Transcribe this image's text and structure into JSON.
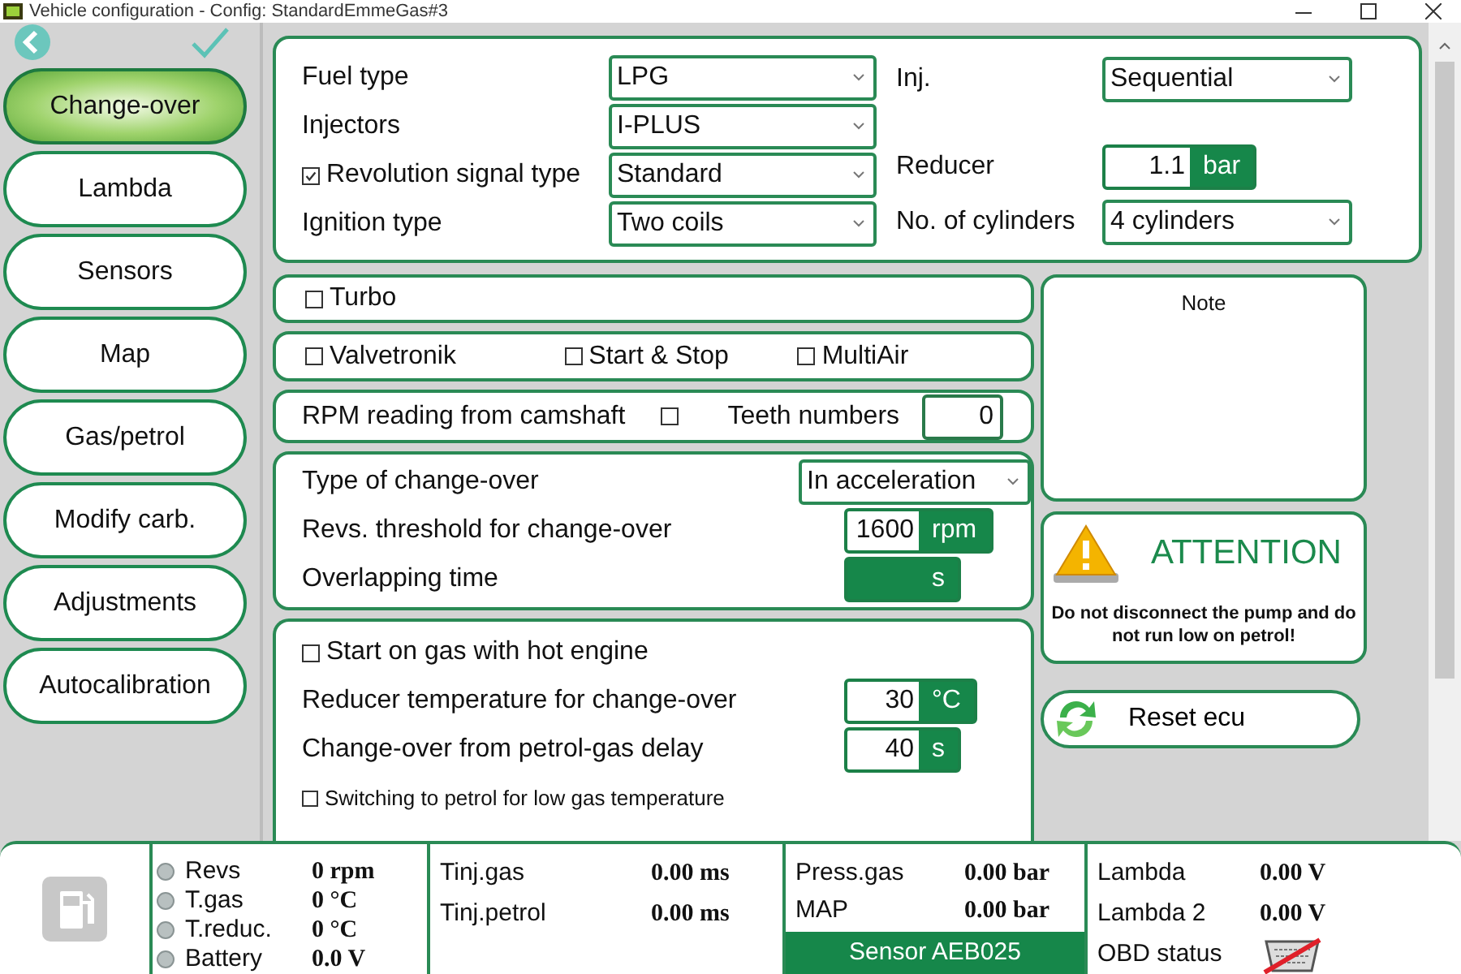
{
  "window": {
    "title": "Vehicle configuration - Config: StandardEmmeGas#3"
  },
  "sidebar": {
    "items": [
      {
        "label": "Change-over",
        "selected": true
      },
      {
        "label": "Lambda",
        "selected": false
      },
      {
        "label": "Sensors",
        "selected": false
      },
      {
        "label": "Map",
        "selected": false
      },
      {
        "label": "Gas/petrol",
        "selected": false
      },
      {
        "label": "Modify carb.",
        "selected": false
      },
      {
        "label": "Adjustments",
        "selected": false
      },
      {
        "label": "Autocalibration",
        "selected": false
      }
    ]
  },
  "engine": {
    "left_fields": [
      {
        "label": "Fuel type",
        "kind": "select",
        "value": "LPG"
      },
      {
        "label": "Injectors",
        "kind": "select",
        "value": "I-PLUS"
      },
      {
        "label": "Revolution signal type",
        "kind": "select",
        "value": "Standard",
        "checked": true
      },
      {
        "label": "Ignition type",
        "kind": "select",
        "value": "Two coils"
      }
    ],
    "right_fields": [
      {
        "label": "Inj.",
        "kind": "select",
        "value": "Sequential"
      },
      {
        "label": "Reducer",
        "kind": "numeric",
        "value": "1.1",
        "unit": "bar"
      },
      {
        "label": "No. of cylinders",
        "kind": "select",
        "value": "4 cylinders"
      }
    ]
  },
  "turbo": {
    "label": "Turbo",
    "checked": false
  },
  "options": [
    {
      "label": "Valvetronik",
      "checked": false
    },
    {
      "label": "Start & Stop",
      "checked": false
    },
    {
      "label": "MultiAir",
      "checked": false
    }
  ],
  "camshaft": {
    "label": "RPM reading from camshaft",
    "checked": false,
    "teeth_label": "Teeth numbers",
    "teeth_value": "0"
  },
  "changeover": {
    "fields": [
      {
        "kind": "select",
        "label": "Type of change-over",
        "value": "In acceleration"
      },
      {
        "kind": "numeric",
        "label": "Revs. threshold for change-over",
        "value": "1600",
        "unit": "rpm"
      },
      {
        "kind": "numeric",
        "label": "Overlapping time",
        "unit": "s"
      }
    ]
  },
  "hot_start": {
    "fields": [
      {
        "kind": "checkbox",
        "label": "Start on gas with hot engine",
        "checked": false
      },
      {
        "kind": "numeric",
        "label": "Reducer temperature for change-over",
        "value": "30",
        "unit": "°C"
      },
      {
        "kind": "numeric",
        "label": "Change-over from petrol-gas delay",
        "value": "40",
        "unit": "s"
      },
      {
        "kind": "small_checkbox",
        "label": "Switching to petrol for low gas temperature",
        "checked": false
      }
    ]
  },
  "note": {
    "title": "Note"
  },
  "attention": {
    "title": "ATTENTION",
    "message": "Do not disconnect the pump and do not run low on petrol!"
  },
  "reset_button": {
    "label": "Reset ecu"
  },
  "status_bar": {
    "engine": [
      {
        "label": "Revs",
        "value": "0 rpm"
      },
      {
        "label": "T.gas",
        "value": "0 °C"
      },
      {
        "label": "T.reduc.",
        "value": "0 °C"
      },
      {
        "label": "Battery",
        "value": "0.0 V"
      }
    ],
    "injection": [
      {
        "label": "Tinj.gas",
        "value": "0.00 ms"
      },
      {
        "label": "Tinj.petrol",
        "value": "0.00 ms"
      }
    ],
    "pressure": [
      {
        "label": "Press.gas",
        "value": "0.00 bar"
      },
      {
        "label": "MAP",
        "value": "0.00 bar"
      }
    ],
    "sensor": "Sensor AEB025",
    "lambda": [
      {
        "label": "Lambda",
        "value": "0.00 V"
      },
      {
        "label": "Lambda 2",
        "value": "0.00 V"
      }
    ],
    "obd_label": "OBD status"
  }
}
